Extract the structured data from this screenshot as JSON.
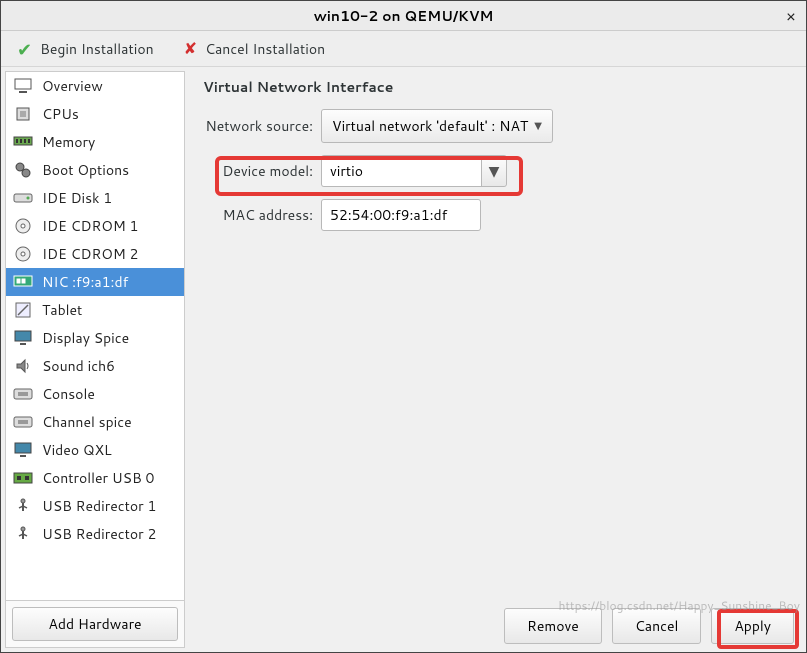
{
  "window": {
    "title": "win10-2 on QEMU/KVM"
  },
  "toolbar": {
    "begin": "Begin Installation",
    "cancel": "Cancel Installation"
  },
  "sidebar": {
    "items": [
      {
        "label": "Overview",
        "icon": "overview-icon"
      },
      {
        "label": "CPUs",
        "icon": "cpu-icon"
      },
      {
        "label": "Memory",
        "icon": "memory-icon"
      },
      {
        "label": "Boot Options",
        "icon": "boot-icon"
      },
      {
        "label": "IDE Disk 1",
        "icon": "disk-icon"
      },
      {
        "label": "IDE CDROM 1",
        "icon": "cdrom-icon"
      },
      {
        "label": "IDE CDROM 2",
        "icon": "cdrom-icon"
      },
      {
        "label": "NIC :f9:a1:df",
        "icon": "nic-icon",
        "selected": true
      },
      {
        "label": "Tablet",
        "icon": "tablet-icon"
      },
      {
        "label": "Display Spice",
        "icon": "display-icon"
      },
      {
        "label": "Sound ich6",
        "icon": "sound-icon"
      },
      {
        "label": "Console",
        "icon": "console-icon"
      },
      {
        "label": "Channel spice",
        "icon": "channel-icon"
      },
      {
        "label": "Video QXL",
        "icon": "video-icon"
      },
      {
        "label": "Controller USB 0",
        "icon": "controller-icon"
      },
      {
        "label": "USB Redirector 1",
        "icon": "usb-icon"
      },
      {
        "label": "USB Redirector 2",
        "icon": "usb-icon"
      }
    ],
    "add_hw": "Add Hardware"
  },
  "panel": {
    "title": "Virtual Network Interface",
    "net_src_label": "Network source:",
    "net_src_value": "Virtual network 'default' : NAT",
    "dev_model_label": "Device model:",
    "dev_model_value": "virtio",
    "mac_label": "MAC address:",
    "mac_value": "52:54:00:f9:a1:df"
  },
  "footer": {
    "remove": "Remove",
    "cancel": "Cancel",
    "apply": "Apply"
  },
  "watermark": "https://blog.csdn.net/Happy_Sunshine_Boy"
}
